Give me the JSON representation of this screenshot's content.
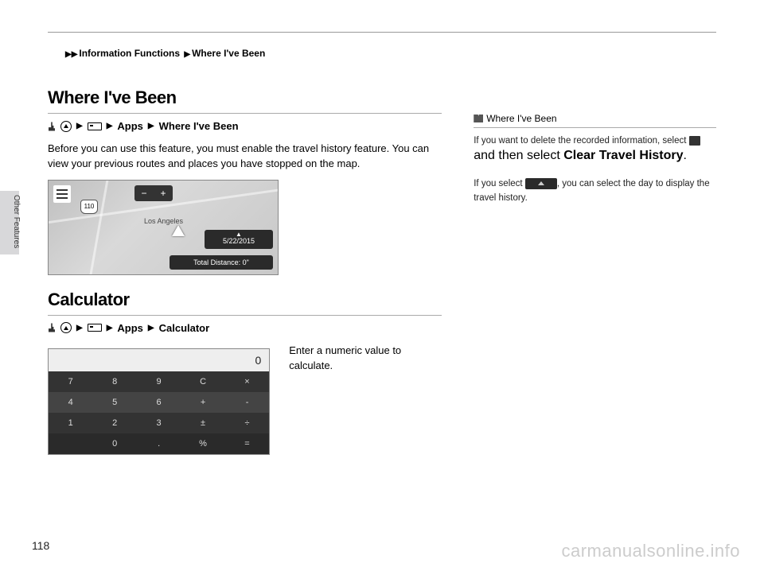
{
  "breadcrumb": {
    "l1": "Information Functions",
    "l2": "Where I've Been"
  },
  "sideLabel": "Other Features",
  "section1": {
    "title": "Where I've Been",
    "nav": {
      "apps": "Apps",
      "item": "Where I've Been"
    },
    "body": "Before you can use this feature, you must enable the travel history feature. You can view your previous routes and places you have stopped on the map.",
    "map": {
      "route": "110",
      "city": "Los Angeles",
      "date": "5/22/2015",
      "dist": "Total Distance: 0\""
    }
  },
  "section2": {
    "title": "Calculator",
    "nav": {
      "apps": "Apps",
      "item": "Calculator"
    },
    "body": "Enter a numeric value to calculate.",
    "calc": {
      "display": "0",
      "keys": [
        "7",
        "8",
        "9",
        "C",
        "×",
        "4",
        "5",
        "6",
        "+",
        "-",
        "1",
        "2",
        "3",
        "±",
        "÷",
        "",
        "0",
        ".",
        "%",
        "="
      ]
    }
  },
  "sidenote": {
    "heading": "Where I've Been",
    "p1a": "If you want to delete the recorded information, select",
    "p1b": "and then select",
    "p1c": "Clear Travel History",
    "p2a": "If you select",
    "p2b": ", you can select the day to display the travel history."
  },
  "pageNumber": "118",
  "watermark": "carmanualsonline.info"
}
